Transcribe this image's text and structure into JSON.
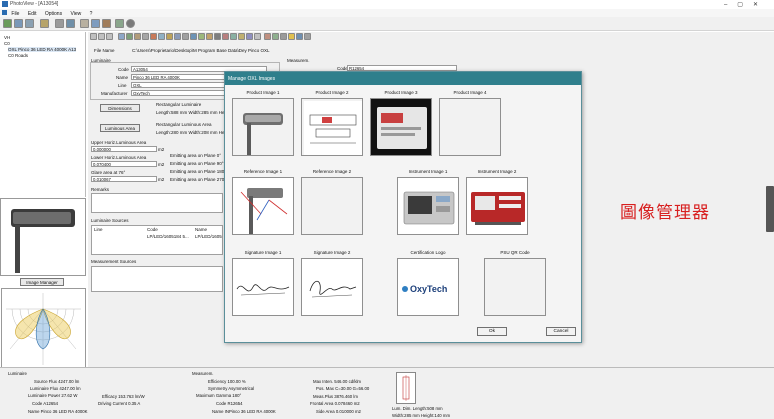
{
  "window": {
    "title": "PhotoView - [A13054]"
  },
  "menu": [
    "File",
    "Edit",
    "Options",
    "View",
    "?"
  ],
  "tree": {
    "items": [
      "VH",
      "C0",
      "OXL Pinco 36 LED RA 4000K A13",
      "C0 Roads"
    ]
  },
  "image_manager_button": "Image Manager",
  "form": {
    "file_name_label": "File Name",
    "file_name_value": "C:\\Users\\Proprietario\\Desktop\\M Program Base Data\\Dey Pinco OXL",
    "luminaire_header": "Luminaire",
    "code_label": "Code",
    "code_value": "A13054",
    "name_label": "Name",
    "name_value": "Pinco 36 LED RA 4000K",
    "line_label": "Line",
    "line_value": "OXL",
    "manufacturer_label": "Manufacturer",
    "manufacturer_value": "OxyTech",
    "dimensions_button": "Dimensions",
    "luminous_area_button": "Luminous Area",
    "rect_luminaire": "Rectangular Luminaire",
    "rect_luminaire_dims": "Length:588 mm Width:285 mm Hei",
    "rect_luminous_area": "Rectangular Luminous Area",
    "rect_luminous_dims": "Length:280 mm Width:208 mm Hei",
    "upper_horiz_label": "Upper Horiz.Luminous Area",
    "upper_horiz_value": "0.000000",
    "lower_horiz_label": "Lower Horiz.Luminous Area",
    "lower_horiz_value": "0.070400",
    "glare_label": "Glare area at 76°",
    "glare_value": "0.010067",
    "unit_m2": "m2",
    "emit_0": "Emitting area on Plane 0°",
    "emit_90": "Emitting area on Plane 90°",
    "emit_180": "Emitting area on Plane 180°",
    "emit_270": "Emitting area on Plane 270°",
    "remarks_label": "Remarks",
    "measurements_header": "Measurem.",
    "meas_code_label": "Code",
    "meas_code_value": "R12654",
    "luminaire_sources_label": "Luminaire Sources",
    "col_line": "Line",
    "col_code": "Code",
    "col_name": "Name",
    "row_code": "LP/LED/1605184 5...",
    "row_name": "LP/LED/1605",
    "measurement_sources_label": "Measurement Sources"
  },
  "modal": {
    "title": "Manage OXL Images",
    "slots": [
      "Product Image 1",
      "Product Image 2",
      "Product Image 3",
      "Product Image 4",
      "Reference Image 1",
      "Reference Image 2",
      "Instrument Image 1",
      "Instrument Image 2",
      "Signature Image 1",
      "Signature Image 2",
      "Certification Logo",
      "PSU QR Code"
    ],
    "logo_text": "OxyTech",
    "ok_label": "Ok",
    "cancel_label": "Cancel"
  },
  "caption": "圖像管理器",
  "bottom": {
    "luminaire_header": "Luminaire",
    "source_flux": "Source Flux    4247.00 lm",
    "luminaire_flux": "Luminaire Flux    4247.00 lm",
    "luminaire_power": "Luminaire Power    27.62 W",
    "code": "Code  A12654",
    "name": "Name  Pinco 36 LED RA 4000K",
    "efficacy": "Efficacy  153.763 lm/W",
    "driving_current": "Driving Current  0.35 A",
    "measurem_header": "Measurem.",
    "efficiency": "Efficiency  100.00 %",
    "symmetry": "Symmetry  Asymmetrical",
    "max_gamma": "Maximum Gamma  180°",
    "meas_code": "Code  R12654",
    "meas_name": "Name  INPinco 36 LED RA 4000K",
    "max_inten": "Max Inten.  546.00 cd/klm",
    "pos_max": "Pos. Max  C=30.00 G=56.00",
    "meas_plus": "Meas.Plus  3876.460 lm",
    "frontal_area": "Frontal Area  0.078460 m2",
    "side_area": "Side Area  0.010000 m2",
    "lum_dim": "Lum. Dim.   Length:508 mm",
    "width_dim": "Width:285 mm Height:140 mm"
  },
  "colors": {
    "modal_title": "#2f7f8c",
    "caption": "#d82020"
  },
  "icons": [
    "app-icon",
    "toolbar-icons",
    "luminaire-thumbnail",
    "polar-diagram"
  ]
}
